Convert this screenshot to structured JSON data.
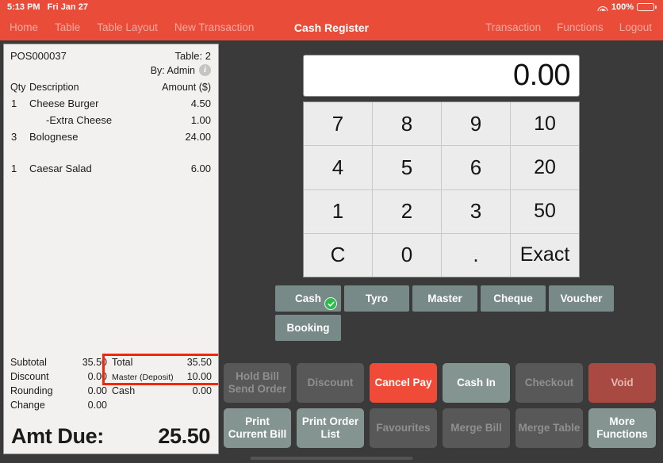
{
  "statusbar": {
    "time": "5:13 PM",
    "date": "Fri Jan 27",
    "battery_percent": "100%",
    "wifi_icon": "wifi-icon",
    "battery_icon": "battery-icon"
  },
  "navbar": {
    "title": "Cash Register",
    "left_items": [
      {
        "label": "Home"
      },
      {
        "label": "Table"
      },
      {
        "label": "Table Layout"
      },
      {
        "label": "New Transaction"
      }
    ],
    "right_items": [
      {
        "label": "Transaction"
      },
      {
        "label": "Functions"
      },
      {
        "label": "Logout"
      }
    ]
  },
  "receipt": {
    "order_id": "POS000037",
    "table_label": "Table: 2",
    "by_label": "By: Admin",
    "info_icon": "info-icon",
    "columns": {
      "qty": "Qty",
      "description": "Description",
      "amount": "Amount ($)"
    },
    "items": [
      {
        "qty": "1",
        "description": "Cheese Burger",
        "amount": "4.50",
        "modifier": false,
        "spaced": false
      },
      {
        "qty": "",
        "description": "-Extra Cheese",
        "amount": "1.00",
        "modifier": true,
        "spaced": false
      },
      {
        "qty": "3",
        "description": "Bolognese",
        "amount": "24.00",
        "modifier": false,
        "spaced": false
      },
      {
        "qty": "1",
        "description": "Caesar Salad",
        "amount": "6.00",
        "modifier": false,
        "spaced": true
      }
    ],
    "totals_left": [
      {
        "label": "Subtotal",
        "value": "35.50"
      },
      {
        "label": "Discount",
        "value": "0.00"
      },
      {
        "label": "Rounding",
        "value": "0.00"
      },
      {
        "label": "Change",
        "value": "0.00"
      }
    ],
    "totals_right": [
      {
        "label": "Total",
        "value": "35.50",
        "small": false
      },
      {
        "label": "Master (Deposit)",
        "value": "10.00",
        "small": true
      },
      {
        "label": "Cash",
        "value": "0.00",
        "small": false
      }
    ],
    "amount_due_label": "Amt Due:",
    "amount_due_value": "25.50",
    "highlight_color": "#f5250a"
  },
  "register": {
    "display_value": "0.00",
    "keypad": [
      {
        "label": "7"
      },
      {
        "label": "8"
      },
      {
        "label": "9"
      },
      {
        "label": "10"
      },
      {
        "label": "4"
      },
      {
        "label": "5"
      },
      {
        "label": "6"
      },
      {
        "label": "20"
      },
      {
        "label": "1"
      },
      {
        "label": "2"
      },
      {
        "label": "3"
      },
      {
        "label": "50"
      },
      {
        "label": "C"
      },
      {
        "label": "0"
      },
      {
        "label": "."
      },
      {
        "label": "Exact"
      }
    ],
    "payment_methods_row1": [
      {
        "label": "Cash",
        "selected": true
      },
      {
        "label": "Tyro",
        "selected": false
      },
      {
        "label": "Master",
        "selected": false
      },
      {
        "label": "Cheque",
        "selected": false
      },
      {
        "label": "Voucher",
        "selected": false
      }
    ],
    "payment_methods_row2": [
      {
        "label": "Booking",
        "selected": false
      }
    ],
    "selected_badge_icon": "check-circle-icon",
    "selected_badge_color": "#2eb84d"
  },
  "actions": {
    "row1": [
      {
        "label": "Hold Bill\nSend Order",
        "state": "disabled"
      },
      {
        "label": "Discount",
        "state": "disabled"
      },
      {
        "label": "Cancel Pay",
        "state": "danger"
      },
      {
        "label": "Cash In",
        "state": "enabled"
      },
      {
        "label": "Checkout",
        "state": "disabled"
      },
      {
        "label": "Void",
        "state": "void"
      }
    ],
    "row2": [
      {
        "label": "Print\nCurrent Bill",
        "state": "enabled"
      },
      {
        "label": "Print Order\nList",
        "state": "enabled"
      },
      {
        "label": "Favourites",
        "state": "disabled"
      },
      {
        "label": "Merge Bill",
        "state": "disabled"
      },
      {
        "label": "Merge Table",
        "state": "disabled"
      },
      {
        "label": "More\nFunctions",
        "state": "enabled"
      }
    ]
  },
  "theme": {
    "accent_red": "#ea4c3a",
    "background": "#3a3a3a",
    "receipt_bg": "#f2f1ef",
    "key_bg": "#ececec",
    "button_enabled": "#839491",
    "button_disabled": "#585858"
  }
}
